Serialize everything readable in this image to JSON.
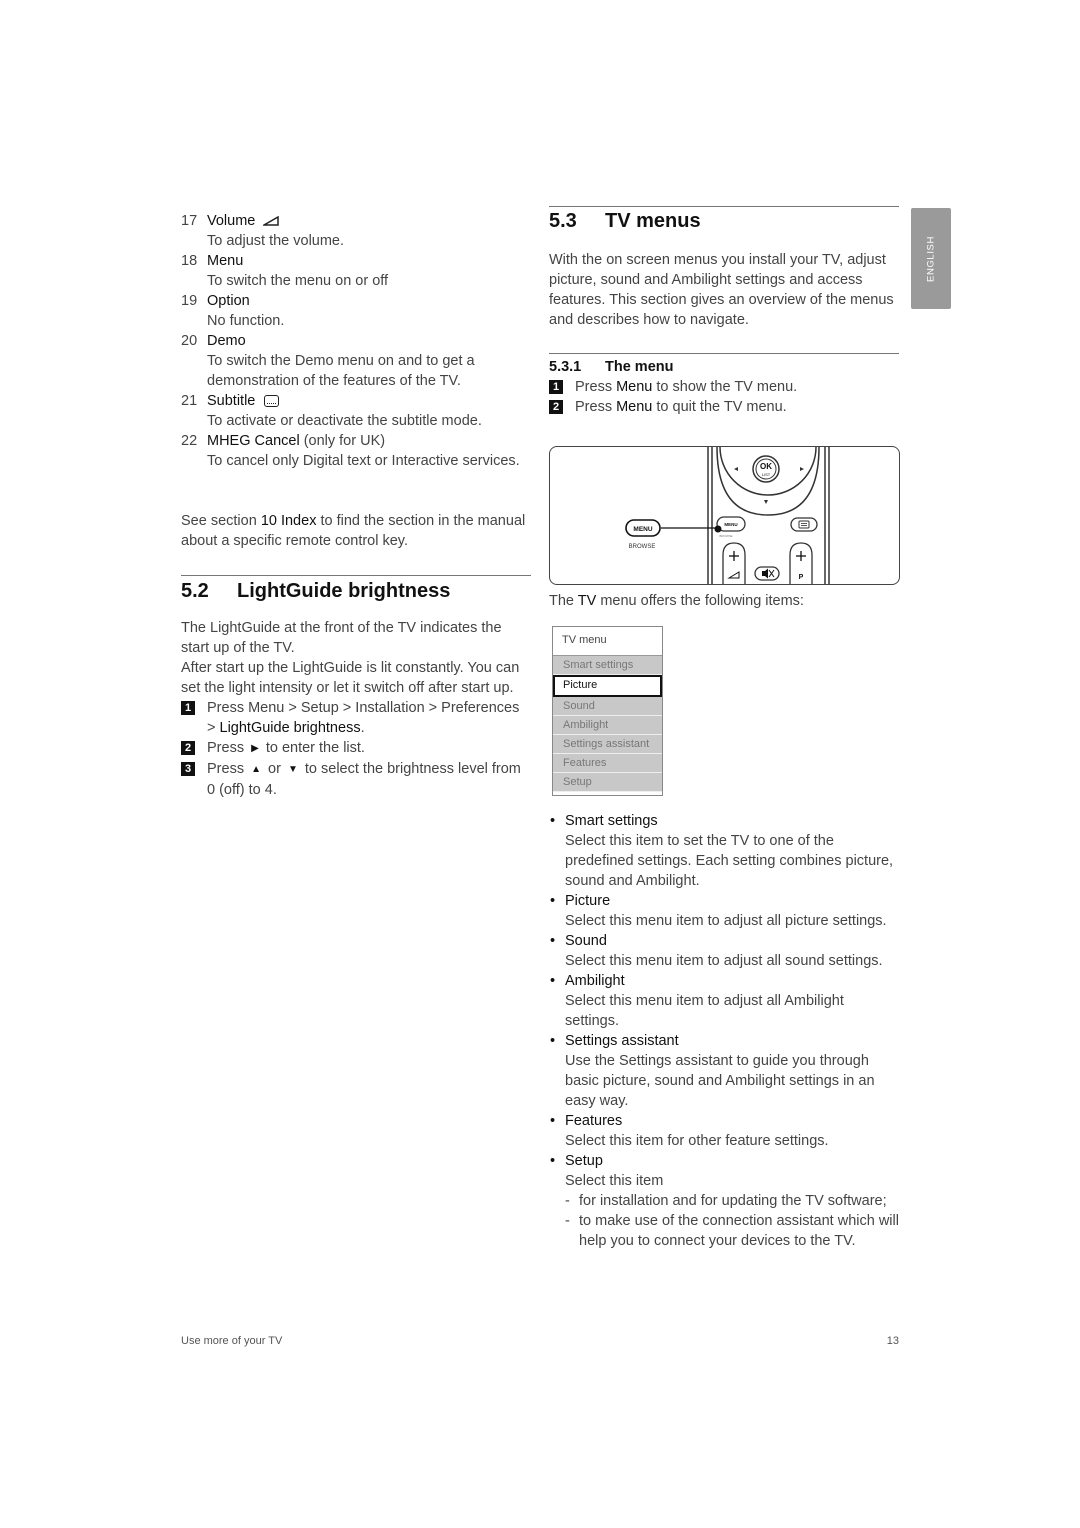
{
  "language_tab": "ENGLISH",
  "left": {
    "keys": [
      {
        "num": "17",
        "label": "Volume",
        "icon": "volume-icon",
        "desc": "To adjust the volume."
      },
      {
        "num": "18",
        "label": "Menu",
        "desc": "To switch the menu on or off"
      },
      {
        "num": "19",
        "label": "Option",
        "desc": "No function."
      },
      {
        "num": "20",
        "label": "Demo",
        "desc": "To switch the Demo menu on and to get a demonstration of the features of the TV."
      },
      {
        "num": "21",
        "label": "Subtitle",
        "icon": "subtitle-icon",
        "desc": "To activate or deactivate the subtitle mode."
      },
      {
        "num": "22",
        "label": "MHEG Cancel",
        "label_suffix": " (only for UK)",
        "desc": "To cancel only Digital text or Interactive services."
      }
    ],
    "see_section": {
      "prefix": "See section ",
      "bold": "10 Index",
      "suffix": " to find the section in the manual about a specific remote control key."
    },
    "section_52": {
      "number": "5.2",
      "title": "LightGuide brightness",
      "para1": "The LightGuide at the front of the TV indicates the start up of the TV.",
      "para2": "After start up the LightGuide is lit constantly. You can set the light intensity or let it switch off after start up.",
      "steps": [
        {
          "n": "1",
          "text_a": "Press Menu > Setup > Installation > Preferences > ",
          "bold": "LightGuide brightness",
          "text_b": "."
        },
        {
          "n": "2",
          "text_a": "Press ",
          "arrow1": "▶",
          "text_b": " to enter the list."
        },
        {
          "n": "3",
          "text_a": "Press ",
          "arrow1": "▲",
          "mid": " or ",
          "arrow2": "▼",
          "text_b": " to select the brightness level from 0 (off) to 4."
        }
      ]
    }
  },
  "right": {
    "section_53": {
      "number": "5.3",
      "title": "TV menus",
      "intro": "With the on screen menus you install your TV, adjust picture, sound and Ambilight settings and access features. This section gives an overview of the menus and describes how to navigate."
    },
    "section_531": {
      "number": "5.3.1",
      "title": "The menu",
      "steps": [
        {
          "n": "1",
          "a": "Press ",
          "bold": "Menu",
          "b": " to show the TV menu."
        },
        {
          "n": "2",
          "a": "Press ",
          "bold": "Menu",
          "b": " to quit the TV menu."
        }
      ]
    },
    "remote": {
      "menu_key": "MENU",
      "browse": "BROWSE",
      "ok": "OK",
      "list": "LIST",
      "p": "P",
      "plus": "+"
    },
    "offers_text": {
      "a": "The ",
      "bold": "TV",
      "b": " menu offers the following items:"
    },
    "tv_menu": {
      "title": "TV menu",
      "items": [
        "Smart settings",
        "Picture",
        "Sound",
        "Ambilight",
        "Settings assistant",
        "Features",
        "Setup"
      ],
      "selected": "Picture"
    },
    "items": [
      {
        "title": "Smart settings",
        "desc": "Select this item to set the TV to one of the predefined settings. Each setting combines picture, sound and Ambilight."
      },
      {
        "title": "Picture",
        "desc": "Select this menu item to adjust all picture settings."
      },
      {
        "title": "Sound",
        "desc": "Select this menu item to adjust all sound settings."
      },
      {
        "title": "Ambilight",
        "desc": "Select this menu item to adjust all Ambilight settings."
      },
      {
        "title": "Settings assistant",
        "desc": "Use the Settings assistant to guide you through basic picture, sound and Ambilight settings in an easy way."
      },
      {
        "title": "Features",
        "desc": "Select this item for other feature settings."
      },
      {
        "title": "Setup",
        "desc": "Select this item",
        "subs": [
          "for installation and for updating the TV software;",
          "to make use of the connection assistant which will help you to connect your devices to the TV."
        ]
      }
    ]
  },
  "footer": {
    "left": "Use more of your TV",
    "page": "13"
  }
}
